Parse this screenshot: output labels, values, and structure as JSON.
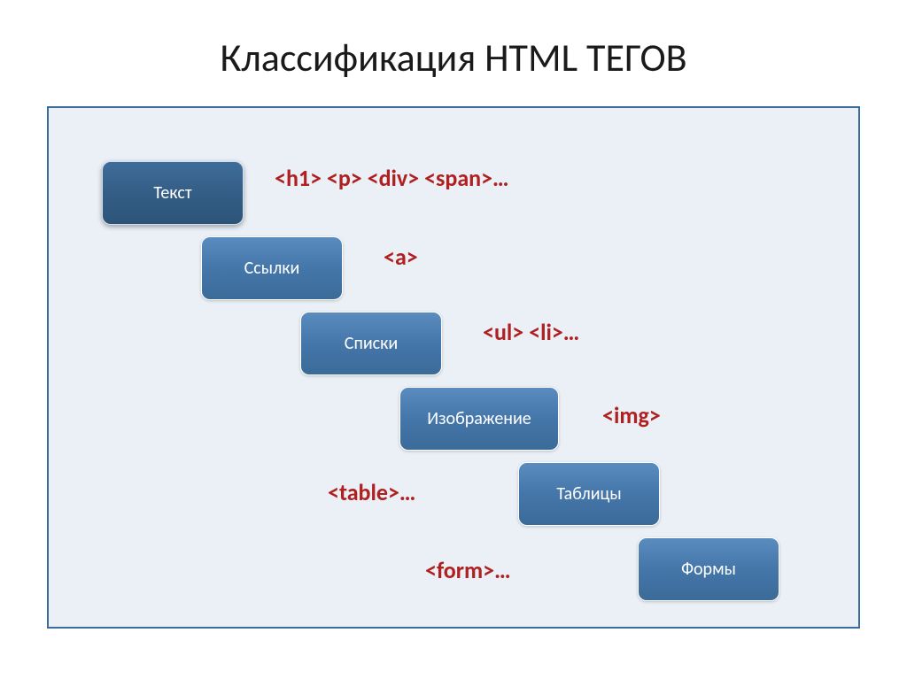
{
  "title": "Классификация HTML ТЕГОВ",
  "steps": [
    {
      "label": "Текст",
      "tags": "<h1> <p> <div> <span>…"
    },
    {
      "label": "Ссылки",
      "tags": "<a>"
    },
    {
      "label": "Списки",
      "tags": "<ul> <li>…"
    },
    {
      "label": "Изображение",
      "tags": "<img>"
    },
    {
      "label": "Таблицы",
      "tags": "<table>…"
    },
    {
      "label": "Формы",
      "tags": "<form>…"
    }
  ]
}
